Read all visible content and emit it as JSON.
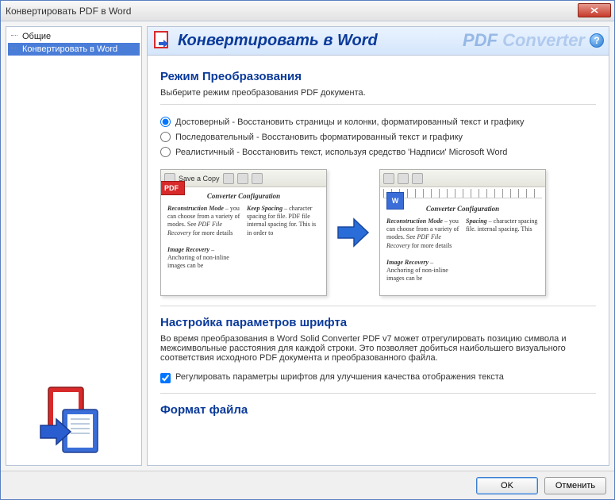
{
  "window": {
    "title": "Конвертировать PDF в Word"
  },
  "sidebar": {
    "items": [
      {
        "label": "Общие"
      },
      {
        "label": "Конвертировать в Word"
      }
    ],
    "selected_index": 1
  },
  "header": {
    "title": "Конвертировать в Word",
    "brand_pdf": "PDF",
    "brand_conv": "Converter",
    "help": "?"
  },
  "section_mode": {
    "title": "Режим Преобразования",
    "desc": "Выберите режим преобразования PDF документа.",
    "options": [
      {
        "label": "Достоверный - Восстановить страницы и колонки, форматированный текст и графику",
        "checked": true
      },
      {
        "label": "Последовательный - Восстановить форматированный текст и графику",
        "checked": false
      },
      {
        "label": "Реалистичный - Восстановить текст, используя средство 'Надписи' Microsoft Word",
        "checked": false
      }
    ]
  },
  "preview": {
    "pdf_badge": "PDF",
    "word_badge": "W",
    "toolbar_save": "Save a Copy",
    "doc_title": "Converter Configuration",
    "sub1": "Reconstruction Mode",
    "body1a": " – you can choose from a variety of modes. See ",
    "body1b": "PDF File Recovery",
    "body1c": " for more details",
    "sub2": "Keep Spacing",
    "body2": " – character spacing for file. PDF file internal spacing for. This is in order to",
    "sub3": "Image Recovery",
    "body3": " – Anchoring of non-inline images can be",
    "word_sub2": "Spacing",
    "word_body2": " – character spacing file. internal spacing. This"
  },
  "section_font": {
    "title": "Настройка параметров шрифта",
    "desc": "Во время преобразования в Word Solid Converter PDF v7 может отрегулировать позицию символа и межсимвольные расстояния для каждой строки. Это позволяет добиться наибольшего визуального соответствия исходного PDF документа и преобразованного файла.",
    "checkbox": "Регулировать параметры шрифтов для улучшения качества отображения текста",
    "checkbox_checked": true
  },
  "section_format": {
    "title": "Формат файла"
  },
  "footer": {
    "ok": "OK",
    "cancel": "Отменить"
  }
}
